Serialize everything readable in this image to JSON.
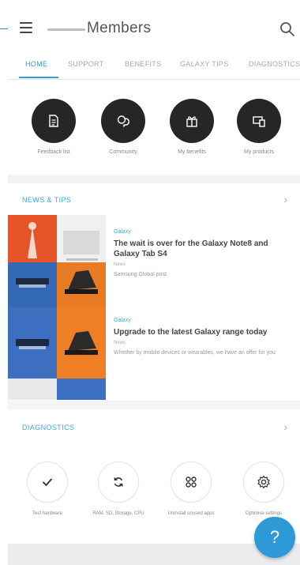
{
  "app": {
    "title": "Members"
  },
  "tabs": [
    {
      "label": "HOME",
      "active": true
    },
    {
      "label": "SUPPORT",
      "active": false
    },
    {
      "label": "BENEFITS",
      "active": false
    },
    {
      "label": "GALAXY TIPS",
      "active": false
    },
    {
      "label": "DIAGNOSTICS",
      "active": false
    }
  ],
  "quick_actions": [
    {
      "label": "Feedback list",
      "icon": "document-icon"
    },
    {
      "label": "Community",
      "icon": "chat-icon"
    },
    {
      "label": "My benefits",
      "icon": "gift-icon"
    },
    {
      "label": "My products",
      "icon": "devices-icon"
    }
  ],
  "news": {
    "title": "NEWS & TIPS",
    "articles": [
      {
        "category": "Galaxy",
        "title": "The wait is over for the Galaxy Note8 and Galaxy Tab S4",
        "meta": "News",
        "desc": "Samsung Global post"
      },
      {
        "category": "Galaxy",
        "title": "Upgrade to the latest Galaxy range today",
        "meta": "News",
        "desc": "Whether by mobile devices or wearables, we have an offer for you"
      }
    ]
  },
  "diagnostics": {
    "title": "DIAGNOSTICS",
    "items": [
      {
        "label": "Test hardware",
        "icon": "checkmark-icon"
      },
      {
        "label": "RAM, SD, Storage, CPU",
        "icon": "refresh-icon"
      },
      {
        "label": "Uninstall unused apps",
        "icon": "apps-grid-icon"
      },
      {
        "label": "Optimise settings",
        "icon": "settings-gear-icon"
      }
    ]
  },
  "fab": {
    "label": "?"
  },
  "colors": {
    "accent": "#2d9ad7",
    "dark_circle": "#262626"
  }
}
